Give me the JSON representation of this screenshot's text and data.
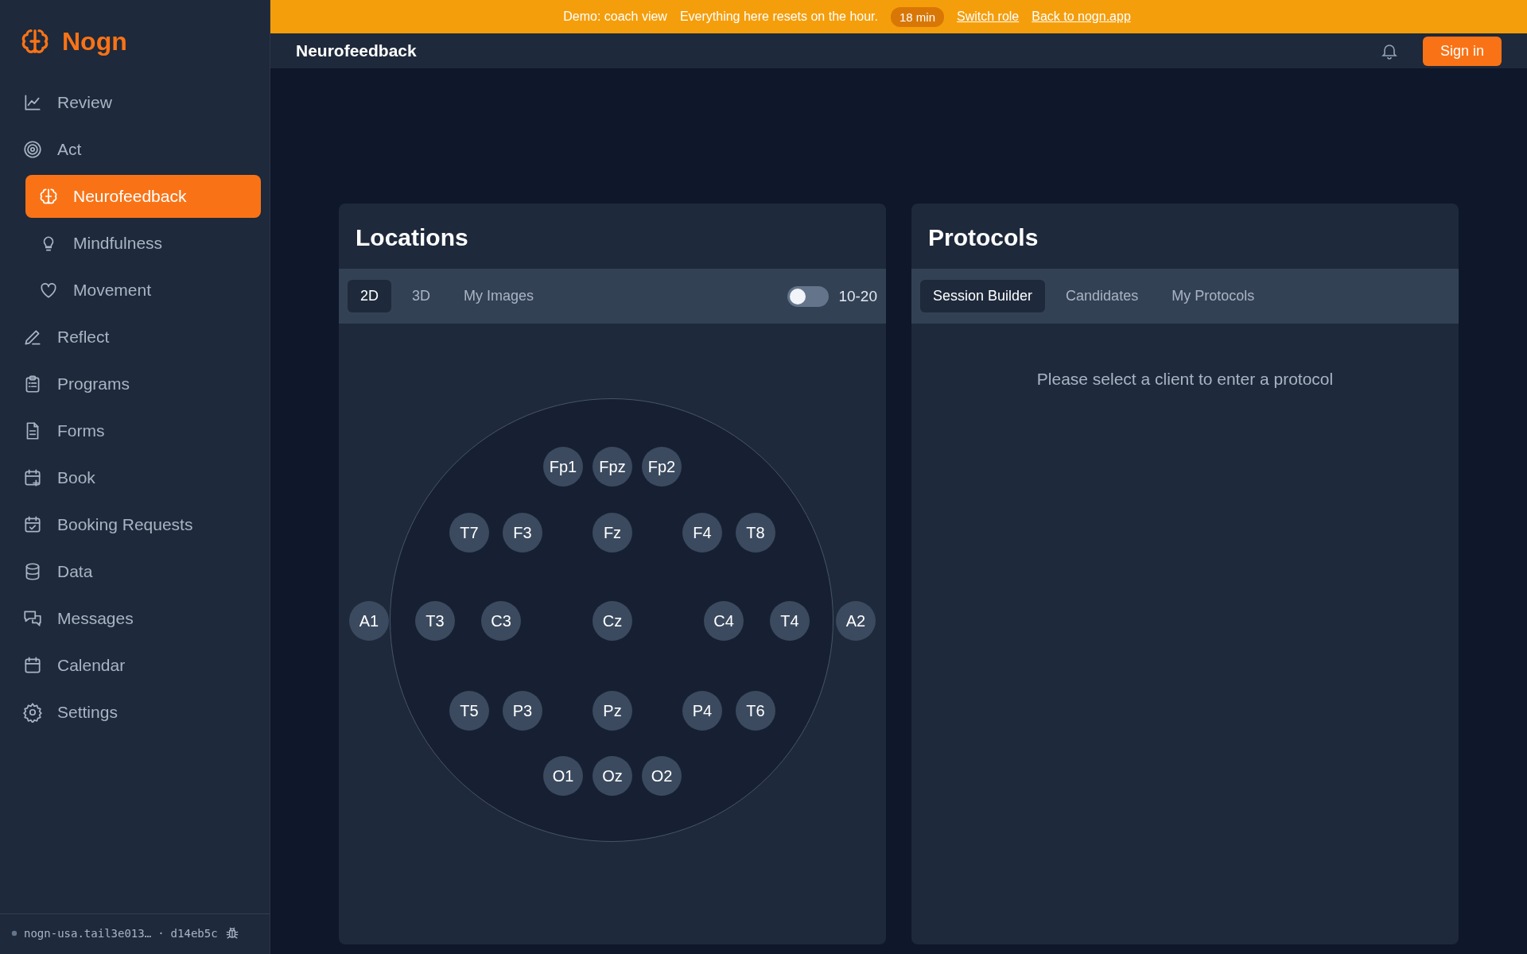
{
  "sidebar": {
    "brand": "Nogn",
    "items": [
      {
        "label": "Review",
        "selected": false
      },
      {
        "label": "Act",
        "selected": false,
        "children": [
          {
            "label": "Neurofeedback",
            "selected": true
          },
          {
            "label": "Mindfulness",
            "selected": false
          },
          {
            "label": "Movement",
            "selected": false
          }
        ]
      },
      {
        "label": "Reflect",
        "selected": false
      },
      {
        "label": "Programs",
        "selected": false
      },
      {
        "label": "Forms",
        "selected": false
      },
      {
        "label": "Book",
        "selected": false
      },
      {
        "label": "Booking Requests",
        "selected": false
      },
      {
        "label": "Data",
        "selected": false
      },
      {
        "label": "Messages",
        "selected": false
      },
      {
        "label": "Calendar",
        "selected": false
      },
      {
        "label": "Settings",
        "selected": false
      }
    ],
    "footer": {
      "host": "nogn-usa.tail3e013…",
      "separator": "·",
      "commit": "d14eb5c"
    }
  },
  "banner": {
    "mode": "Demo: coach view",
    "message": "Everything here resets on the hour.",
    "timer": "18 min",
    "links": [
      "Switch role",
      "Back to nogn.app"
    ]
  },
  "header": {
    "title": "Neurofeedback",
    "sign_in": "Sign in"
  },
  "locations": {
    "title": "Locations",
    "tabs": [
      {
        "label": "2D",
        "selected": true
      },
      {
        "label": "3D",
        "selected": false
      },
      {
        "label": "My Images",
        "selected": false
      }
    ],
    "toggle": {
      "label": "10-20",
      "on": false
    },
    "electrodes": [
      "Fp1",
      "Fpz",
      "Fp2",
      "T7",
      "F3",
      "Fz",
      "F4",
      "T8",
      "A1",
      "T3",
      "C3",
      "Cz",
      "C4",
      "T4",
      "A2",
      "T5",
      "P3",
      "Pz",
      "P4",
      "T6",
      "O1",
      "Oz",
      "O2"
    ]
  },
  "protocols": {
    "title": "Protocols",
    "tabs": [
      {
        "label": "Session Builder",
        "selected": true
      },
      {
        "label": "Candidates",
        "selected": false
      },
      {
        "label": "My Protocols",
        "selected": false
      }
    ],
    "message": "Please select a client to enter a protocol"
  }
}
